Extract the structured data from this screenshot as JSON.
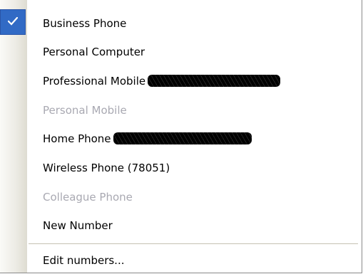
{
  "menu": {
    "items": [
      {
        "label": "Business Phone",
        "checked": true,
        "enabled": true,
        "redacted": false
      },
      {
        "label": "Personal Computer",
        "checked": false,
        "enabled": true,
        "redacted": false
      },
      {
        "label": "Professional Mobile",
        "checked": false,
        "enabled": true,
        "redacted": true
      },
      {
        "label": "Personal Mobile",
        "checked": false,
        "enabled": false,
        "redacted": false
      },
      {
        "label": "Home Phone",
        "checked": false,
        "enabled": true,
        "redacted": true
      },
      {
        "label": "Wireless Phone (78051)",
        "checked": false,
        "enabled": true,
        "redacted": false
      },
      {
        "label": "Colleague Phone",
        "checked": false,
        "enabled": false,
        "redacted": false
      },
      {
        "label": "New Number",
        "checked": false,
        "enabled": true,
        "redacted": false
      }
    ],
    "footer_item": {
      "label": "Edit numbers...",
      "enabled": true
    },
    "colors": {
      "selection": "#316ac5",
      "disabled_text": "#a9a9b2",
      "text": "#000000"
    },
    "check_icon": "checkmark-icon"
  }
}
